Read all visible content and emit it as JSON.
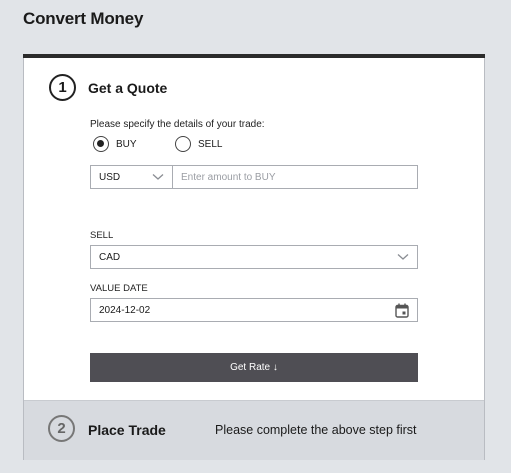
{
  "page": {
    "title": "Convert Money"
  },
  "step1": {
    "number": "1",
    "title": "Get a Quote",
    "instructions": "Please specify the details of your trade:",
    "radio": {
      "buy_label": "BUY",
      "sell_label": "SELL",
      "selected": "BUY"
    },
    "buy_currency": "USD",
    "amount": {
      "value": "",
      "placeholder": "Enter amount to BUY"
    },
    "sell": {
      "label": "SELL",
      "value": "CAD"
    },
    "value_date": {
      "label": "VALUE DATE",
      "value": "2024-12-02"
    },
    "get_rate_label": "Get Rate ↓"
  },
  "step2": {
    "number": "2",
    "title": "Place Trade",
    "note": "Please complete the above step first"
  },
  "icons": {
    "chevron": "chevron-down-icon",
    "calendar": "calendar-icon"
  },
  "colors": {
    "background": "#e1e4e8",
    "button": "#4f4e54",
    "step2_background": "#d7dadf",
    "card_top_border": "#2b2b2b"
  }
}
